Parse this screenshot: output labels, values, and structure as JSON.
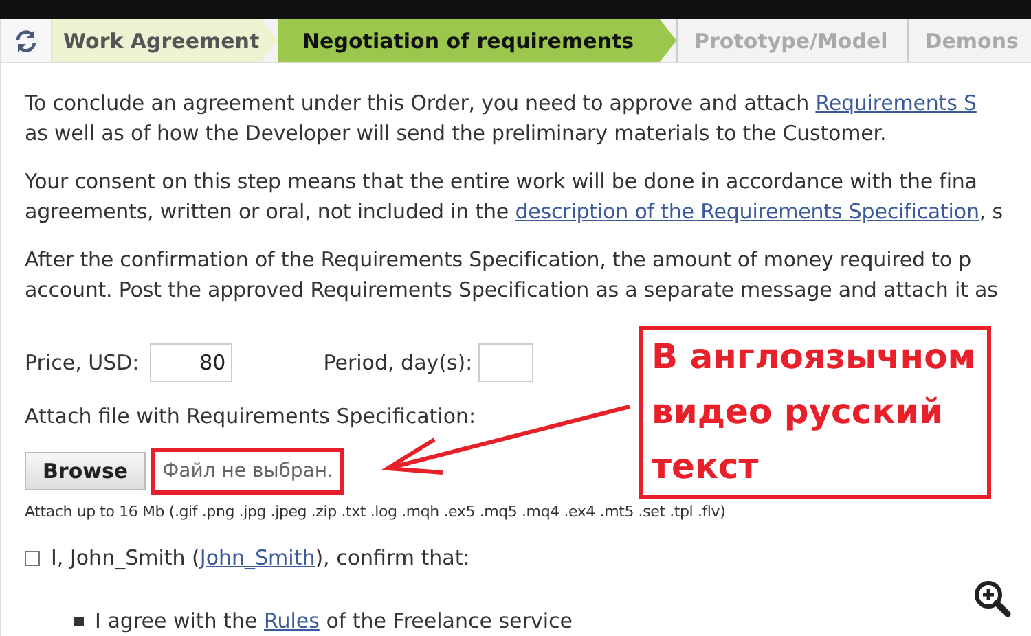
{
  "steps": [
    {
      "label": "Work Agreement",
      "selected": false,
      "completed": true
    },
    {
      "label": "Negotiation of requirements",
      "selected": true,
      "completed": false
    },
    {
      "label": "Prototype/Model",
      "selected": false,
      "completed": false
    },
    {
      "label": "Demons",
      "selected": false,
      "completed": false
    }
  ],
  "paragraphs": [
    {
      "lines": [
        [
          {
            "text": "To conclude an agreement under this Order, you need to approve and attach ",
            "link": false
          },
          {
            "text": "Requirements S",
            "link": true
          }
        ],
        [
          {
            "text": "as well as of how the Developer will send the preliminary materials to the Customer.",
            "link": false
          }
        ]
      ]
    },
    {
      "lines": [
        [
          {
            "text": "Your consent on this step means that the entire work will be done in accordance with the fina",
            "link": false
          }
        ],
        [
          {
            "text": "agreements, written or oral, not included in the ",
            "link": false
          },
          {
            "text": "description of the Requirements Specification",
            "link": true
          },
          {
            "text": ", s",
            "link": false
          }
        ]
      ]
    },
    {
      "lines": [
        [
          {
            "text": "After the confirmation of the Requirements Specification, the amount of money required to p",
            "link": false
          }
        ],
        [
          {
            "text": "account. Post the approved Requirements Specification as a separate message and attach it as",
            "link": false
          }
        ]
      ]
    }
  ],
  "price": {
    "label": "Price, USD:",
    "value": "80"
  },
  "period": {
    "label": "Period, day(s):"
  },
  "attach": {
    "label": "Attach file with Requirements Specification:",
    "button": "Browse",
    "file_status": "Файл не выбран.",
    "note": "Attach up to 16 Mb (.gif .png .jpg .jpeg .zip .txt .log .mqh .ex5 .mq5 .mq4 .ex4 .mt5 .set .tpl .flv)"
  },
  "confirm": {
    "checked": false,
    "parts": [
      {
        "text": "I, John_Smith (",
        "link": false
      },
      {
        "text": "John_Smith",
        "link": true
      },
      {
        "text": "), confirm that:",
        "link": false
      }
    ]
  },
  "bullets": [
    [
      {
        "text": "I agree with the ",
        "link": false
      },
      {
        "text": "Rules",
        "link": true
      },
      {
        "text": " of the Freelance service",
        "link": false
      }
    ]
  ],
  "annotation": {
    "text": "В англоязычном видео русский текст"
  }
}
